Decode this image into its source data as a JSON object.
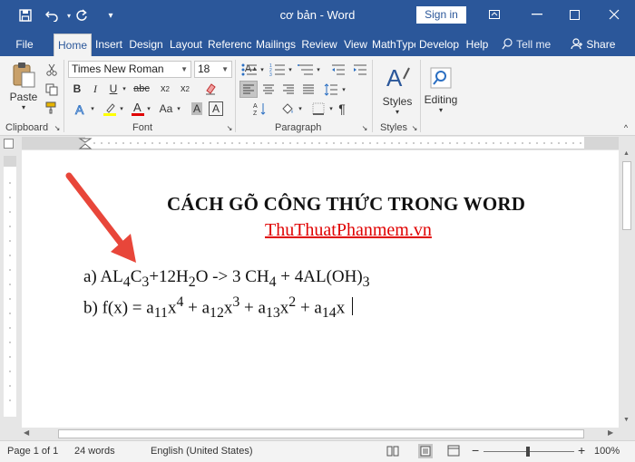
{
  "window": {
    "title": "cơ bản  -  Word",
    "sign_in": "Sign in"
  },
  "tabs": [
    {
      "label": "File"
    },
    {
      "label": "Home"
    },
    {
      "label": "Insert"
    },
    {
      "label": "Design"
    },
    {
      "label": "Layout"
    },
    {
      "label": "References"
    },
    {
      "label": "Mailings"
    },
    {
      "label": "Review"
    },
    {
      "label": "View"
    },
    {
      "label": "MathType"
    },
    {
      "label": "Develop"
    },
    {
      "label": "Help"
    }
  ],
  "tell_me": "Tell me",
  "share": "Share",
  "ribbon": {
    "clipboard": {
      "label": "Clipboard",
      "paste": "Paste"
    },
    "font": {
      "label": "Font",
      "family": "Times New Roman",
      "size": "18"
    },
    "paragraph": {
      "label": "Paragraph"
    },
    "styles": {
      "label": "Styles",
      "button": "Styles"
    },
    "editing": {
      "button": "Editing"
    }
  },
  "document": {
    "heading": "CÁCH GÕ CÔNG THỨC TRONG WORD",
    "site": "ThuThuatPhanmem.vn",
    "eq_a": {
      "prefix": "a) AL",
      "s1": "4",
      "p2": "C",
      "s2": "3",
      "p3": "+12H",
      "s3": "2",
      "p4": "O -> 3 CH",
      "s4": "4",
      "p5": " + 4AL(OH)",
      "s5": "3"
    },
    "eq_b": {
      "prefix": "b) f(x) = a",
      "s1": "11",
      "p2": "x",
      "e1": "4",
      "p3": " + a",
      "s2": "12",
      "p4": "x",
      "e2": "3",
      "p5": " + a",
      "s3": "13",
      "p6": "x",
      "e3": "2",
      "p7": " + a",
      "s4": "14",
      "p8": "x"
    }
  },
  "status": {
    "page": "Page 1 of 1",
    "words": "24 words",
    "language": "English (United States)",
    "zoom": "100%"
  }
}
